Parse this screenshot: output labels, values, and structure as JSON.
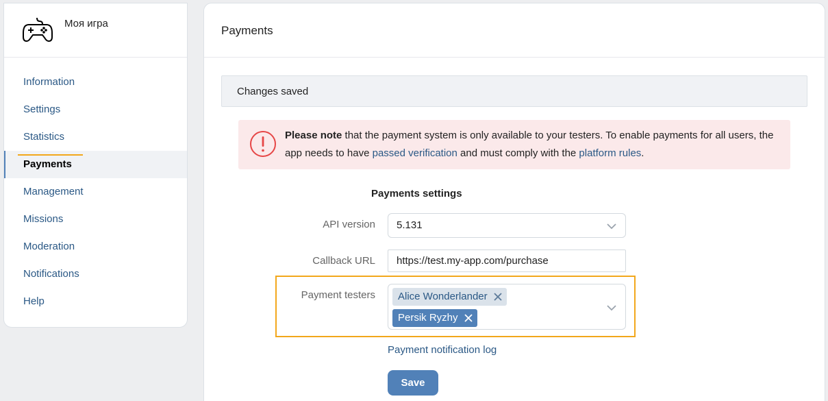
{
  "app": {
    "title": "Моя игра",
    "icon": "gamepad-icon"
  },
  "sidebar": {
    "items": [
      {
        "label": "Information"
      },
      {
        "label": "Settings"
      },
      {
        "label": "Statistics"
      },
      {
        "label": "Payments",
        "active": true
      },
      {
        "label": "Management"
      },
      {
        "label": "Missions"
      },
      {
        "label": "Moderation"
      },
      {
        "label": "Notifications"
      },
      {
        "label": "Help"
      }
    ]
  },
  "main": {
    "title": "Payments",
    "saved_message": "Changes saved",
    "note": {
      "icon": "alert-circle-icon",
      "bold": "Please note",
      "text1": " that the payment system is only available to your testers. To enable payments for all users, the app needs to have ",
      "link1": "passed verification",
      "text2": " and must comply with the ",
      "link2": "platform rules",
      "text3": "."
    },
    "section_title": "Payments settings",
    "api_version": {
      "label": "API version",
      "value": "5.131"
    },
    "callback_url": {
      "label": "Callback URL",
      "value": "https://test.my-app.com/purchase"
    },
    "payment_testers": {
      "label": "Payment testers",
      "testers": [
        "Alice Wonderlander",
        "Persik Ryzhy"
      ]
    },
    "log_link": "Payment notification log",
    "save_label": "Save"
  },
  "colors": {
    "accent": "#5181b8",
    "link": "#2a5885",
    "highlight": "#f2a71b",
    "note_bg": "#fbe9ea",
    "note_icon": "#e64646"
  }
}
